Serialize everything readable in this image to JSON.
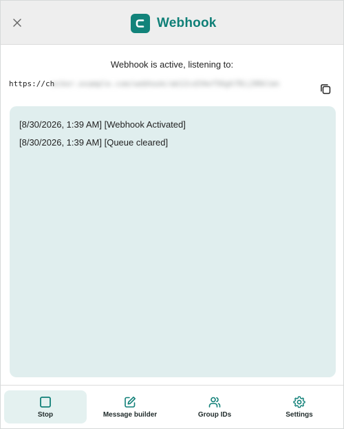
{
  "header": {
    "title": "Webhook",
    "close_icon": "close-icon",
    "logo_icon": "c-logo-icon",
    "brand_color": "#0f7f77"
  },
  "status": {
    "text": "Webhook is active, listening to:",
    "url_visible_prefix": "https://ch",
    "url_obscured": "ecker.example.com/webhook/ab12cd34ef56gh78ij90klmn"
  },
  "copy_icon": "copy-icon",
  "log": {
    "lines": [
      "[8/30/2026, 1:39 AM] [Webhook Activated]",
      "[8/30/2026, 1:39 AM] [Queue cleared]"
    ]
  },
  "nav": {
    "items": [
      {
        "label": "Stop",
        "icon": "stop-icon",
        "active": true
      },
      {
        "label": "Message builder",
        "icon": "edit-icon",
        "active": false
      },
      {
        "label": "Group IDs",
        "icon": "users-icon",
        "active": false
      },
      {
        "label": "Settings",
        "icon": "gear-icon",
        "active": false
      }
    ]
  },
  "colors": {
    "accent": "#0f7f77",
    "log_bg": "#e0eeee",
    "active_nav_bg": "#e4f1f0"
  }
}
